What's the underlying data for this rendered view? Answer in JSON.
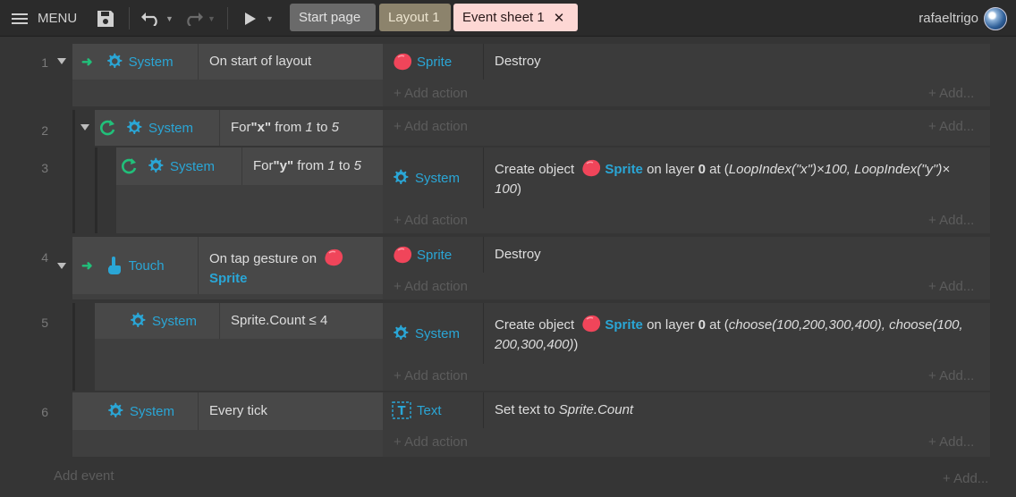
{
  "toolbar": {
    "menu_label": "MENU",
    "user_name": "rafaeltrigo",
    "tabs": [
      {
        "label": "Start page"
      },
      {
        "label": "Layout 1"
      },
      {
        "label": "Event sheet 1"
      }
    ]
  },
  "events": [
    {
      "number": "1",
      "cond_object": "System",
      "cond_text": "On start of layout",
      "act_object": "Sprite",
      "act_text": "Destroy"
    },
    {
      "number": "2",
      "cond_object": "System",
      "cond_prefix": "For ",
      "cond_var": "\"x\"",
      "cond_from": " from ",
      "cond_lo": "1",
      "cond_to": " to ",
      "cond_hi": "5"
    },
    {
      "number": "3",
      "cond_object": "System",
      "cond_prefix": "For ",
      "cond_var": "\"y\"",
      "cond_from": " from ",
      "cond_lo": "1",
      "cond_to": " to ",
      "cond_hi": "5",
      "act_object": "System",
      "act_pre": "Create object ",
      "act_sprite": "Sprite",
      "act_mid": " on layer ",
      "act_layer": "0",
      "act_at": " at (",
      "act_expr_line1": "LoopIndex(\"x\")×100, LoopIndex(\"y\")×",
      "act_expr_line2": "100",
      "act_close": ")"
    },
    {
      "number": "4",
      "cond_object": "Touch",
      "cond_text": "On tap gesture on ",
      "cond_sprite": "Sprite",
      "act_object": "Sprite",
      "act_text": "Destroy"
    },
    {
      "number": "5",
      "cond_object": "System",
      "cond_text": "Sprite.Count ≤ 4",
      "act_object": "System",
      "act_pre": "Create object ",
      "act_sprite": "Sprite",
      "act_mid": " on layer ",
      "act_layer": "0",
      "act_at": " at (",
      "act_expr_line1": "choose(100,200,300,400), choose(100,",
      "act_expr_line2": "200,300,400)",
      "act_close": ")"
    },
    {
      "number": "6",
      "cond_object": "System",
      "cond_text": "Every tick",
      "act_object": "Text",
      "act_pre": "Set text to ",
      "act_expr": "Sprite.Count"
    }
  ],
  "labels": {
    "add_action": "+ Add action",
    "add_more": "+ Add...",
    "add_event": "Add event"
  },
  "colors": {
    "background": "#353535",
    "object_blue": "#2aa6d6",
    "trigger_green": "#21c07a",
    "active_tab": "#fdd7d4",
    "layout_tab": "#8c836c"
  },
  "icons": [
    "menu-icon",
    "save-icon",
    "undo-icon",
    "redo-icon",
    "play-icon",
    "close-icon",
    "gear-icon",
    "sprite-icon",
    "trigger-arrow-icon",
    "loop-icon",
    "touch-icon",
    "text-icon"
  ]
}
